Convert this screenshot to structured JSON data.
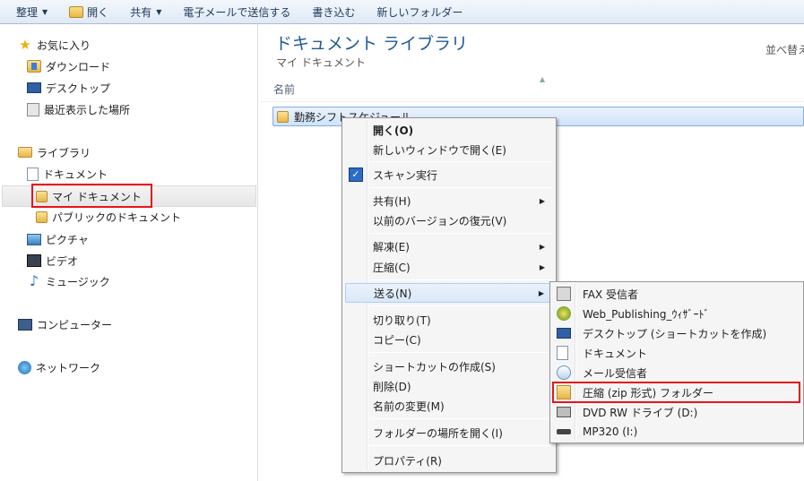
{
  "toolbar": {
    "organize": "整理",
    "open": "開く",
    "share": "共有",
    "email": "電子メールで送信する",
    "burn": "書き込む",
    "new_folder": "新しいフォルダー"
  },
  "nav": {
    "favorites": "お気に入り",
    "downloads": "ダウンロード",
    "desktop": "デスクトップ",
    "recent": "最近表示した場所",
    "libraries": "ライブラリ",
    "documents": "ドキュメント",
    "my_documents": "マイ ドキュメント",
    "public_documents": "パブリックのドキュメント",
    "pictures": "ピクチャ",
    "videos": "ビデオ",
    "music": "ミュージック",
    "computer": "コンピューター",
    "network": "ネットワーク"
  },
  "main": {
    "title": "ドキュメント ライブラリ",
    "subtitle": "マイ ドキュメント",
    "arrange": "並べ替え",
    "column_name": "名前",
    "file_name": "勤務シフトスケジュール"
  },
  "context_menu": {
    "open": "開く(O)",
    "open_new_window": "新しいウィンドウで開く(E)",
    "scan": "スキャン実行",
    "share": "共有(H)",
    "restore": "以前のバージョンの復元(V)",
    "extract": "解凍(E)",
    "compress": "圧縮(C)",
    "send_to": "送る(N)",
    "cut": "切り取り(T)",
    "copy": "コピー(C)",
    "create_shortcut": "ショートカットの作成(S)",
    "delete": "削除(D)",
    "rename": "名前の変更(M)",
    "open_location": "フォルダーの場所を開く(I)",
    "properties": "プロパティ(R)"
  },
  "send_to_menu": {
    "fax": "FAX 受信者",
    "web_publishing": "Web_Publishing_ｳｨｻﾞｰﾄﾞ",
    "desktop_shortcut": "デスクトップ (ショートカットを作成)",
    "documents": "ドキュメント",
    "mail": "メール受信者",
    "zip": "圧縮 (zip 形式) フォルダー",
    "dvd": "DVD RW ドライブ (D:)",
    "mp320": "MP320 (I:)"
  },
  "colors": {
    "highlight_red": "#e8141b",
    "title_blue": "#1e5a95",
    "selection_blue": "#cfe3fa"
  }
}
